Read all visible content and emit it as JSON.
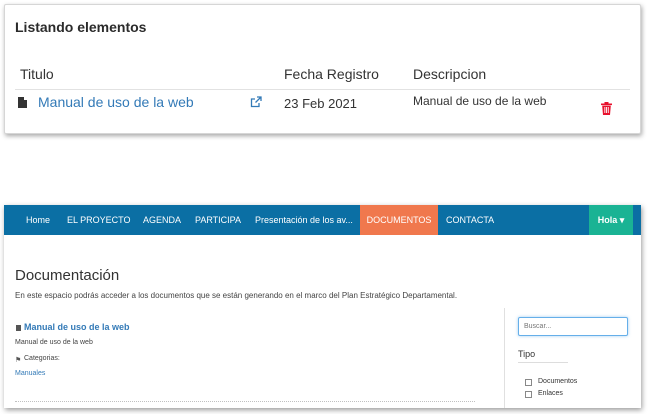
{
  "listing": {
    "title": "Listando elementos",
    "columns": [
      "Titulo",
      "Fecha Registro",
      "Descripcion"
    ],
    "rows": [
      {
        "title": "Manual de uso de la web",
        "date": "23 Feb 2021",
        "description": "Manual de uso de la web",
        "doc_icon": "file-icon",
        "link_icon": "external-link-icon",
        "delete_icon": "trash-icon",
        "delete_color": "#e8112d"
      }
    ]
  },
  "site": {
    "nav": {
      "items": [
        "Home",
        "EL PROYECTO",
        "AGENDA",
        "PARTICIPA",
        "Presentación de los av...",
        "DOCUMENTOS",
        "CONTACTA"
      ],
      "active": "DOCUMENTOS",
      "user_menu": "Hola ▾",
      "bar_color": "#0b6fa4",
      "active_color": "#f0784d",
      "user_color": "#1ab394"
    },
    "page": {
      "title": "Documentación",
      "intro": "En este espacio podrás acceder a los documentos que se están generando en el marco del Plan Estratégico Departamental."
    },
    "item": {
      "title": "Manual de uso de la web",
      "description": "Manual de uso de la web",
      "categories_label": "Categorias:",
      "category": "Manuales"
    },
    "sidebar": {
      "search_placeholder": "Buscar...",
      "type_label": "Tipo",
      "options": [
        "Documentos",
        "Enlaces"
      ]
    }
  }
}
